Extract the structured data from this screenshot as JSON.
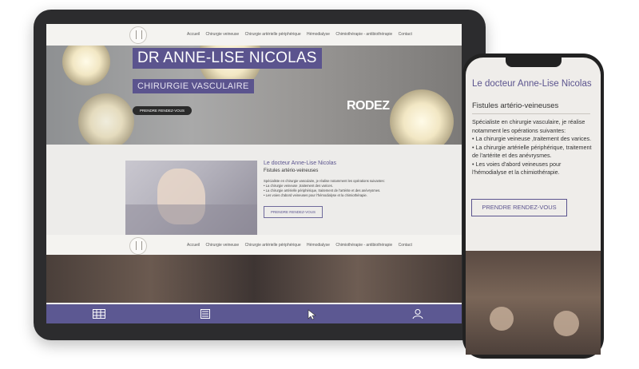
{
  "nav": {
    "items": [
      "Accueil",
      "Chirurgie veineuse",
      "Chirurgie artérielle périphérique",
      "Hémodialyse",
      "Chimiothérapie - antibiothérapie",
      "Contact"
    ]
  },
  "hero": {
    "title": "DR ANNE-LISE NICOLAS",
    "subtitle": "CHIRURGIE VASCULAIRE",
    "cta": "PRENDRE RENDEZ-VOUS",
    "city": "RODEZ"
  },
  "section": {
    "title": "Le docteur Anne-Lise Nicolas",
    "subtitle": "Fistules artério-veineuses",
    "intro": "Spécialiste en chirurgie vasculaire, je réalise notamment les opérations suivantes:",
    "items": [
      "• La chirurgie veineuse ,traitement des varices.",
      "• La chirurgie artérielle périphérique, traitement de l'artérite et des anévrysmes.",
      "• Les voies d'abord veineuses pour l'hémodialyse et la chimiothérapie."
    ],
    "cta": "PRENDRE RENDEZ-VOUS"
  },
  "bottom_bar": {
    "icons": [
      "table-icon",
      "list-icon",
      "cursor-icon",
      "user-icon"
    ]
  },
  "phone": {
    "title": "Le docteur Anne-Lise Nicolas",
    "subtitle": "Fistules artério-veineuses",
    "intro": "Spécialiste en chirurgie vasculaire, je réalise notamment les opérations suivantes:",
    "items": [
      "• La chirurgie veineuse ,traitement des varices.",
      "• La chirurgie artérielle périphérique, traitement de l'artérite et des anévrysmes.",
      "• Les voies d'abord veineuses pour l'hémodialyse et la chimiothérapie."
    ],
    "cta": "PRENDRE RENDEZ-VOUS"
  },
  "colors": {
    "accent": "#5b548e"
  }
}
